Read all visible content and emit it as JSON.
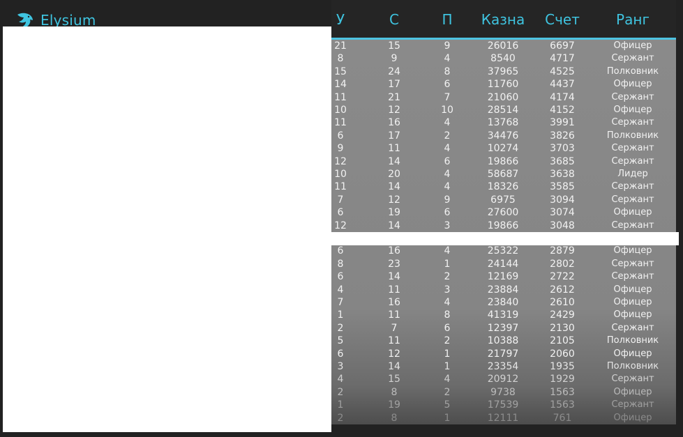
{
  "brand": {
    "name": "Elysium",
    "icon": "eagle-icon",
    "color": "#3fc4e0"
  },
  "table": {
    "columns": [
      "У",
      "С",
      "П",
      "Казна",
      "Счет",
      "Ранг"
    ],
    "rows": [
      [
        "21",
        "15",
        "9",
        "26016",
        "6697",
        "Офицер"
      ],
      [
        "8",
        "9",
        "4",
        "8540",
        "4717",
        "Сержант"
      ],
      [
        "15",
        "24",
        "8",
        "37965",
        "4525",
        "Полковник"
      ],
      [
        "14",
        "17",
        "6",
        "11760",
        "4437",
        "Офицер"
      ],
      [
        "11",
        "21",
        "7",
        "21060",
        "4174",
        "Сержант"
      ],
      [
        "10",
        "12",
        "10",
        "28514",
        "4152",
        "Офицер"
      ],
      [
        "11",
        "16",
        "4",
        "13768",
        "3991",
        "Сержант"
      ],
      [
        "6",
        "17",
        "2",
        "34476",
        "3826",
        "Полковник"
      ],
      [
        "9",
        "11",
        "4",
        "10274",
        "3703",
        "Сержант"
      ],
      [
        "12",
        "14",
        "6",
        "19866",
        "3685",
        "Сержант"
      ],
      [
        "10",
        "20",
        "4",
        "58687",
        "3638",
        "Лидер"
      ],
      [
        "11",
        "14",
        "4",
        "18326",
        "3585",
        "Сержант"
      ],
      [
        "7",
        "12",
        "9",
        "6975",
        "3094",
        "Сержант"
      ],
      [
        "6",
        "19",
        "6",
        "27600",
        "3074",
        "Офицер"
      ],
      [
        "12",
        "14",
        "3",
        "19866",
        "3048",
        "Сержант"
      ],
      [
        "6",
        "16",
        "4",
        "25322",
        "2879",
        "Офицер"
      ],
      [
        "8",
        "23",
        "1",
        "24144",
        "2802",
        "Сержант"
      ],
      [
        "6",
        "14",
        "2",
        "12169",
        "2722",
        "Сержант"
      ],
      [
        "4",
        "11",
        "3",
        "23884",
        "2612",
        "Офицер"
      ],
      [
        "7",
        "16",
        "4",
        "23840",
        "2610",
        "Офицер"
      ],
      [
        "1",
        "11",
        "8",
        "41319",
        "2429",
        "Офицер"
      ],
      [
        "2",
        "7",
        "6",
        "12397",
        "2130",
        "Сержант"
      ],
      [
        "5",
        "11",
        "2",
        "10388",
        "2105",
        "Полковник"
      ],
      [
        "6",
        "12",
        "1",
        "21797",
        "2060",
        "Офицер"
      ],
      [
        "3",
        "14",
        "1",
        "23354",
        "1935",
        "Полковник"
      ],
      [
        "4",
        "15",
        "4",
        "20912",
        "1929",
        "Сержант"
      ],
      [
        "2",
        "8",
        "2",
        "9738",
        "1563",
        "Офицер"
      ],
      [
        "1",
        "19",
        "5",
        "17539",
        "1563",
        "Сержант"
      ],
      [
        "2",
        "8",
        "1",
        "12111",
        "761",
        "Офицер"
      ]
    ]
  }
}
